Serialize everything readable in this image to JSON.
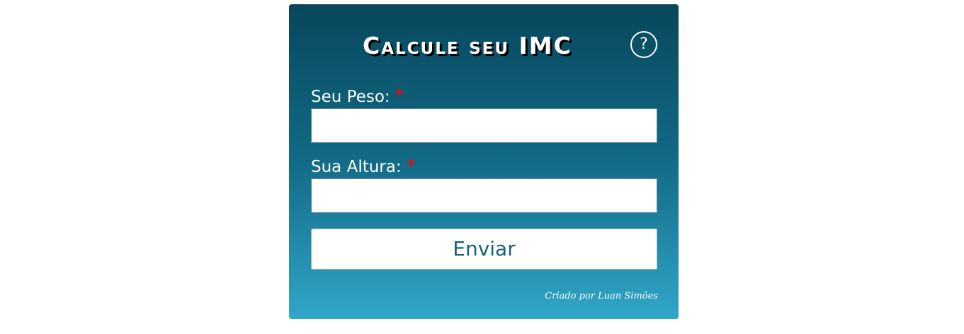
{
  "form": {
    "title": "Calcule seu IMC",
    "help_label": "?",
    "weight": {
      "label": "Seu Peso:",
      "required_marker": "*",
      "value": ""
    },
    "height": {
      "label": "Sua Altura:",
      "required_marker": "*",
      "value": ""
    },
    "submit_label": "Enviar",
    "footer_text": "Criado por Luan Simões"
  },
  "colors": {
    "card_top": "#07475c",
    "card_bottom": "#31a6c9",
    "required": "#ff0000",
    "submit_text": "#145f7b"
  }
}
